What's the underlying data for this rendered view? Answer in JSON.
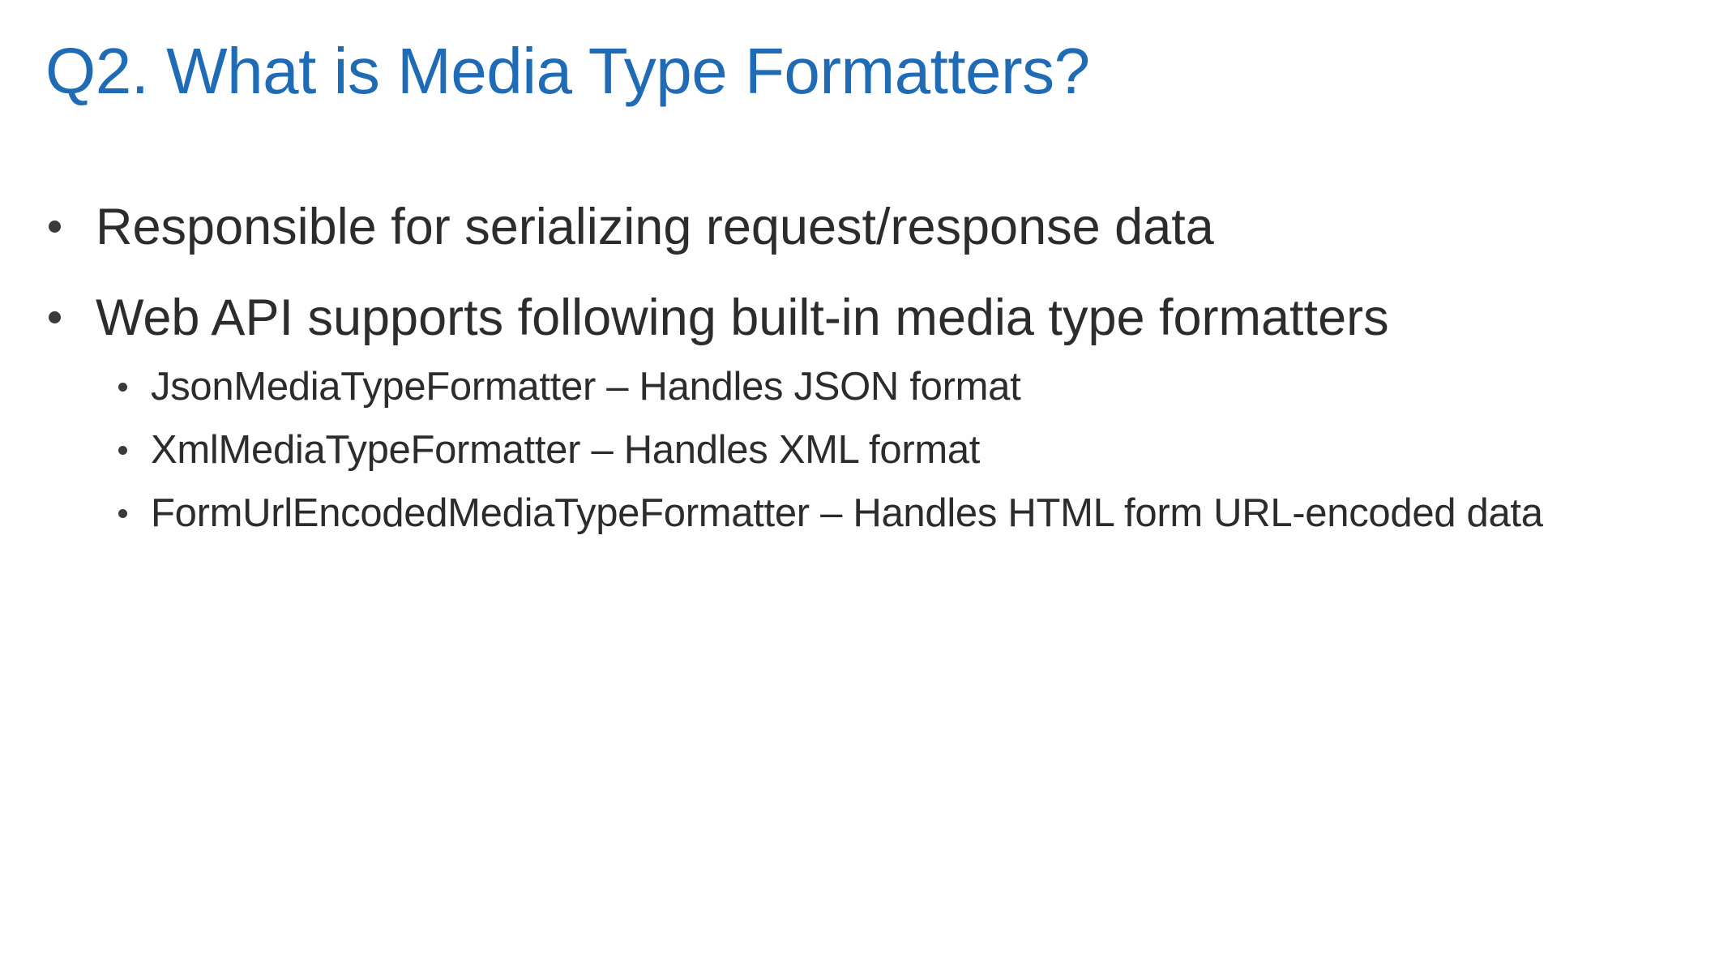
{
  "colors": {
    "title": "#1f6bb5",
    "text": "#2c2c2c",
    "bullet": "#3a3a3a"
  },
  "slide": {
    "title": "Q2. What is Media Type Formatters?",
    "bullets": [
      {
        "text": "Responsible for serializing request/response data",
        "icon": "bullet-dot-icon"
      },
      {
        "text": "Web API supports following built-in media type formatters",
        "icon": "bullet-dot-icon",
        "sub_bullets": [
          {
            "text": "JsonMediaTypeFormatter – Handles JSON format",
            "icon": "bullet-dot-icon"
          },
          {
            "text": "XmlMediaTypeFormatter – Handles XML format",
            "icon": "bullet-dot-icon"
          },
          {
            "text": "FormUrlEncodedMediaTypeFormatter – Handles HTML form URL-encoded data",
            "icon": "bullet-dot-icon"
          }
        ]
      }
    ]
  }
}
